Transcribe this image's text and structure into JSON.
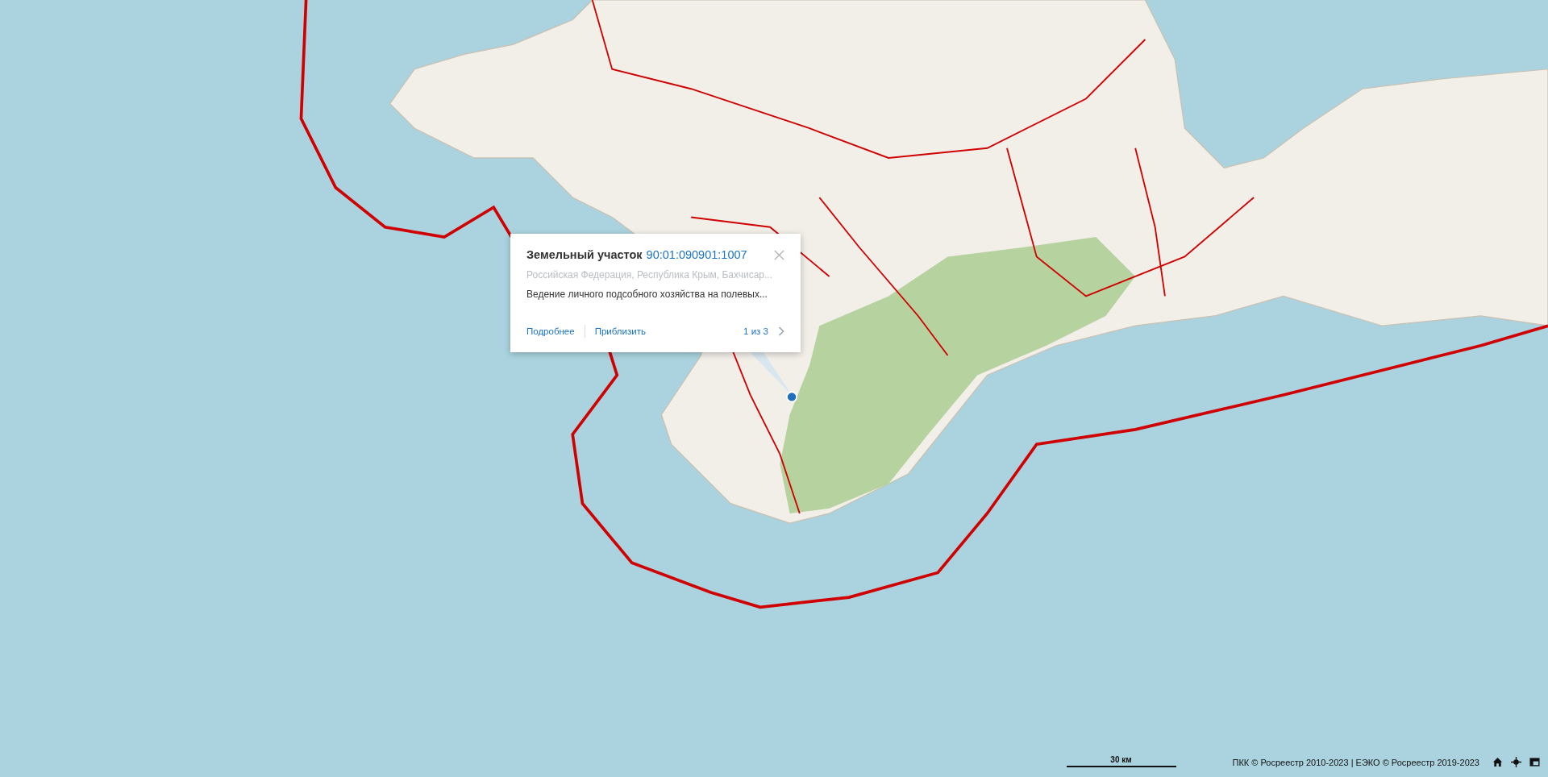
{
  "popup": {
    "title": "Земельный участок",
    "cadastral_number": "90:01:090901:1007",
    "address": "Российская Федерация, Республика Крым, Бахчисар...",
    "purpose": "Ведение личного подсобного хозяйства на полевых...",
    "links": [
      "Подробнее",
      "Приблизить"
    ],
    "pager": "1 из 3"
  },
  "scale": {
    "label": "30 км"
  },
  "attribution": "ПКК © Росреестр 2010-2023 | ЕЭКО © Росреестр 2019-2023"
}
